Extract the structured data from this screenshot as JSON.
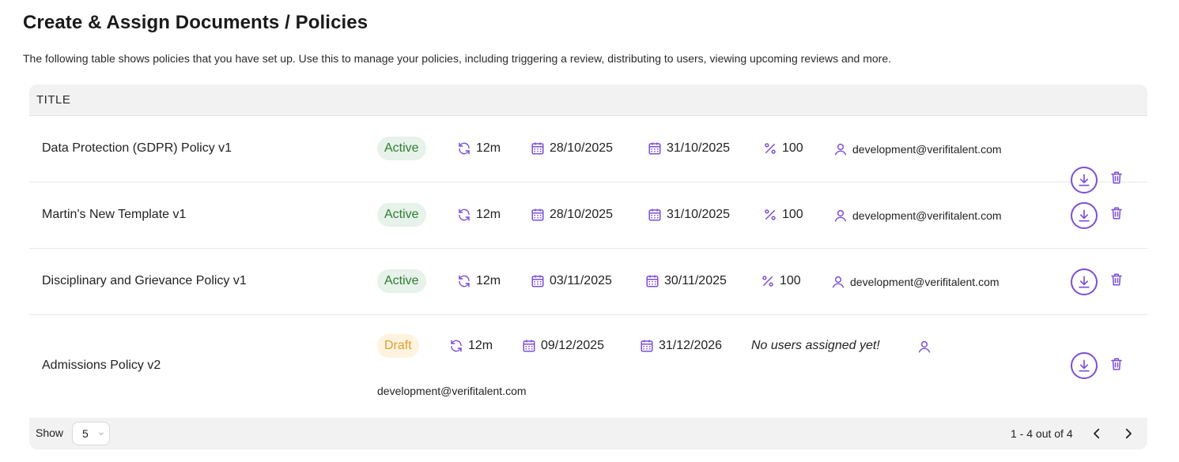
{
  "page": {
    "title": "Create & Assign Documents / Policies",
    "description": "The following table shows policies that you have set up. Use this to manage your policies, including triggering a review, distributing to users, viewing upcoming reviews and more."
  },
  "table": {
    "header_title": "TITLE",
    "rows": [
      {
        "title": "Data Protection (GDPR) Policy v1",
        "status": "Active",
        "cycle": "12m",
        "start_date": "28/10/2025",
        "review_date": "31/10/2025",
        "percent": "100",
        "user": "development@verifitalent.com"
      },
      {
        "title": "Martin's New Template v1",
        "status": "Active",
        "cycle": "12m",
        "start_date": "28/10/2025",
        "review_date": "31/10/2025",
        "percent": "100",
        "user": "development@verifitalent.com"
      },
      {
        "title": "Disciplinary and Grievance Policy v1",
        "status": "Active",
        "cycle": "12m",
        "start_date": "03/11/2025",
        "review_date": "30/11/2025",
        "percent": "100",
        "user": "development@verifitalent.com"
      },
      {
        "title": "Admissions Policy v2",
        "status": "Draft",
        "cycle": "12m",
        "start_date": "09/12/2025",
        "review_date": "31/12/2026",
        "note": "No users assigned yet!",
        "user": "development@verifitalent.com"
      }
    ]
  },
  "footer": {
    "show_label": "Show",
    "page_size": "5",
    "range_text": "1 - 4 out of 4"
  },
  "colors": {
    "accent": "#7b4fd6",
    "active_bg": "#e6f2ea",
    "active_text": "#2e7d32",
    "draft_bg": "#fdf3df",
    "draft_text": "#e0a030"
  },
  "icons": [
    "refresh-icon",
    "calendar-icon",
    "percent-icon",
    "user-icon",
    "download-icon",
    "trash-icon",
    "chevron-left-icon",
    "chevron-right-icon",
    "chevron-down-icon"
  ]
}
